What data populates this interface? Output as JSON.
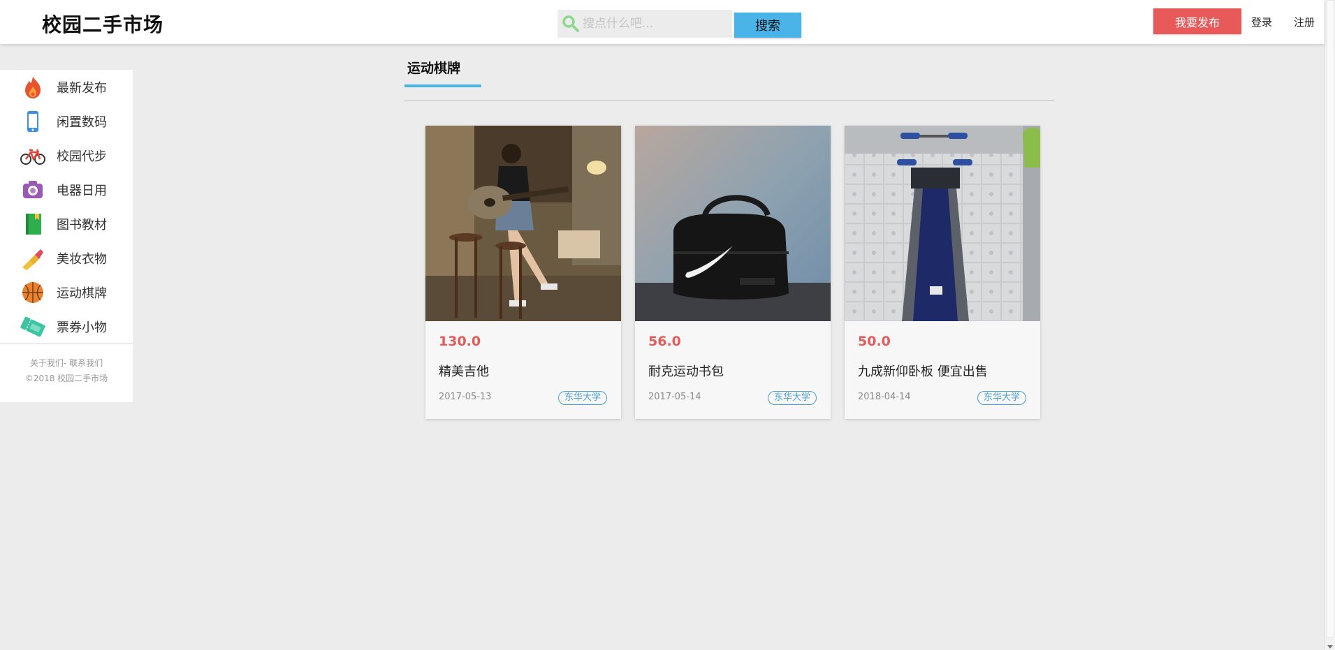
{
  "header": {
    "logo": "校园二手市场",
    "search_placeholder": "搜点什么吧...",
    "search_value": "",
    "search_button": "搜索",
    "publish_button": "我要发布",
    "login": "登录",
    "register": "注册"
  },
  "sidebar": {
    "items": [
      {
        "label": "最新发布",
        "icon": "fire-icon"
      },
      {
        "label": "闲置数码",
        "icon": "phone-icon"
      },
      {
        "label": "校园代步",
        "icon": "bicycle-icon"
      },
      {
        "label": "电器日用",
        "icon": "camera-icon"
      },
      {
        "label": "图书教材",
        "icon": "book-icon"
      },
      {
        "label": "美妆衣物",
        "icon": "lipstick-icon"
      },
      {
        "label": "运动棋牌",
        "icon": "basketball-icon"
      },
      {
        "label": "票券小物",
        "icon": "ticket-icon"
      }
    ],
    "footer_about": "关于我们",
    "footer_sep": "- ",
    "footer_contact": "联系我们",
    "copyright": "©2018 校园二手市场"
  },
  "main": {
    "section_title": "运动棋牌",
    "products": [
      {
        "price": "130.0",
        "title": "精美吉他",
        "date": "2017-05-13",
        "school": "东华大学",
        "image": "guitar-girl-photo"
      },
      {
        "price": "56.0",
        "title": "耐克运动书包",
        "date": "2017-05-14",
        "school": "东华大学",
        "image": "nike-bag-photo"
      },
      {
        "price": "50.0",
        "title": "九成新仰卧板 便宜出售",
        "date": "2018-04-14",
        "school": "东华大学",
        "image": "situp-bench-photo"
      }
    ]
  },
  "colors": {
    "accent": "#4ab3e8",
    "publish": "#e85a5a",
    "price": "#e35b5b",
    "tag": "#4a9fd8",
    "background": "#ececec"
  }
}
